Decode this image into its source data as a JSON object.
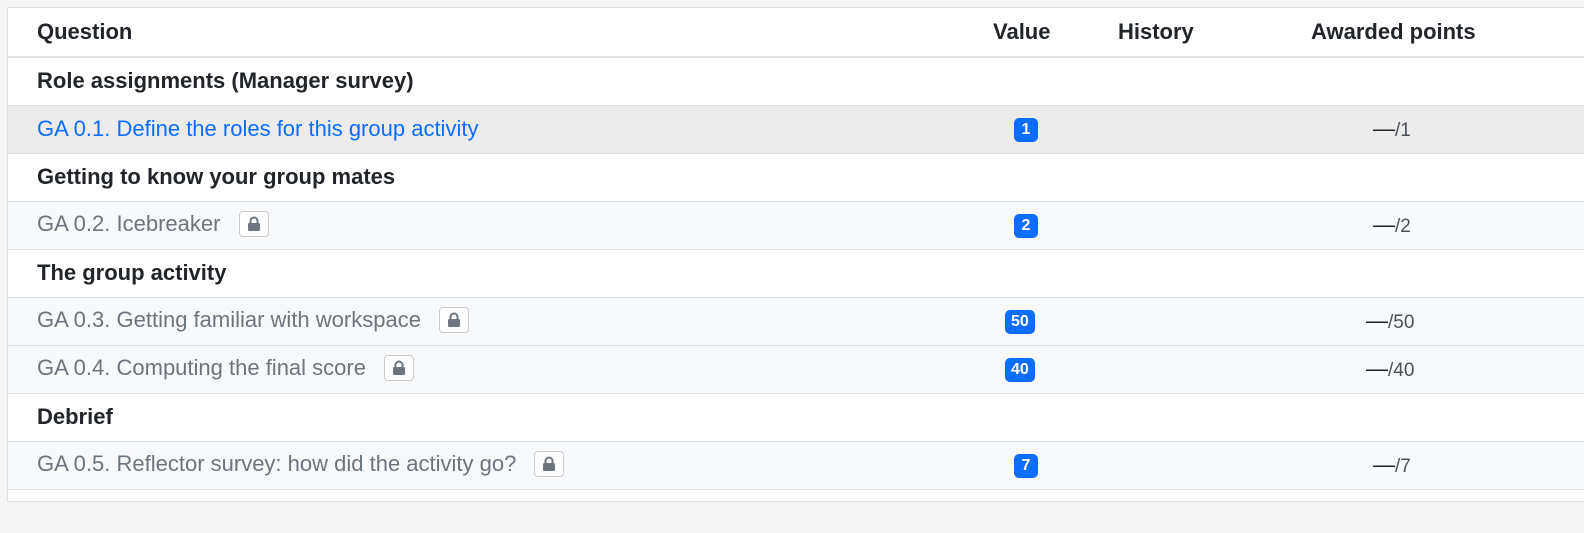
{
  "table": {
    "headers": {
      "question": "Question",
      "value": "Value",
      "history": "History",
      "awarded": "Awarded points"
    },
    "groups": [
      {
        "title": "Role assignments (Manager survey)",
        "items": [
          {
            "label": "GA 0.1. Define the roles for this group activity",
            "value": "1",
            "dash": "—",
            "total": "/1",
            "locked": false,
            "link": true
          }
        ]
      },
      {
        "title": "Getting to know your group mates",
        "items": [
          {
            "label": "GA 0.2. Icebreaker",
            "value": "2",
            "dash": "—",
            "total": "/2",
            "locked": true,
            "link": false
          }
        ]
      },
      {
        "title": "The group activity",
        "items": [
          {
            "label": "GA 0.3. Getting familiar with workspace",
            "value": "50",
            "dash": "—",
            "total": "/50",
            "locked": true,
            "link": false
          },
          {
            "label": "GA 0.4. Computing the final score",
            "value": "40",
            "dash": "—",
            "total": "/40",
            "locked": true,
            "link": false
          }
        ]
      },
      {
        "title": "Debrief",
        "items": [
          {
            "label": "GA 0.5. Reflector survey: how did the activity go?",
            "value": "7",
            "dash": "—",
            "total": "/7",
            "locked": true,
            "link": false
          }
        ]
      }
    ]
  },
  "icons": {
    "lock": "lock-icon"
  },
  "colors": {
    "accent": "#0d6efd",
    "muted_text": "#6c757d",
    "active_row": "#ececec"
  }
}
